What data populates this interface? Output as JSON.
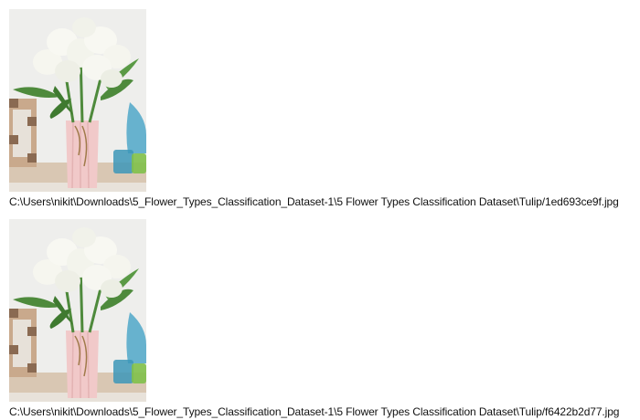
{
  "results": [
    {
      "image_alt": "white tulips in pink vase",
      "caption": "C:\\Users\\nikit\\Downloads\\5_Flower_Types_Classification_Dataset-1\\5 Flower Types Classification Dataset\\Tulip/1ed693ce9f.jpg"
    },
    {
      "image_alt": "white tulips in pink vase",
      "caption": "C:\\Users\\nikit\\Downloads\\5_Flower_Types_Classification_Dataset-1\\5 Flower Types Classification Dataset\\Tulip/f6422b2d77.jpg"
    }
  ],
  "colors": {
    "wall": "#eeeeec",
    "table": "#d6c4b0",
    "vase": "#f1c9c9",
    "leaf": "#4e8a3c",
    "petal": "#f8f8f2",
    "blue_glass": "#4fa7c9",
    "green_glass": "#7fc04a"
  }
}
